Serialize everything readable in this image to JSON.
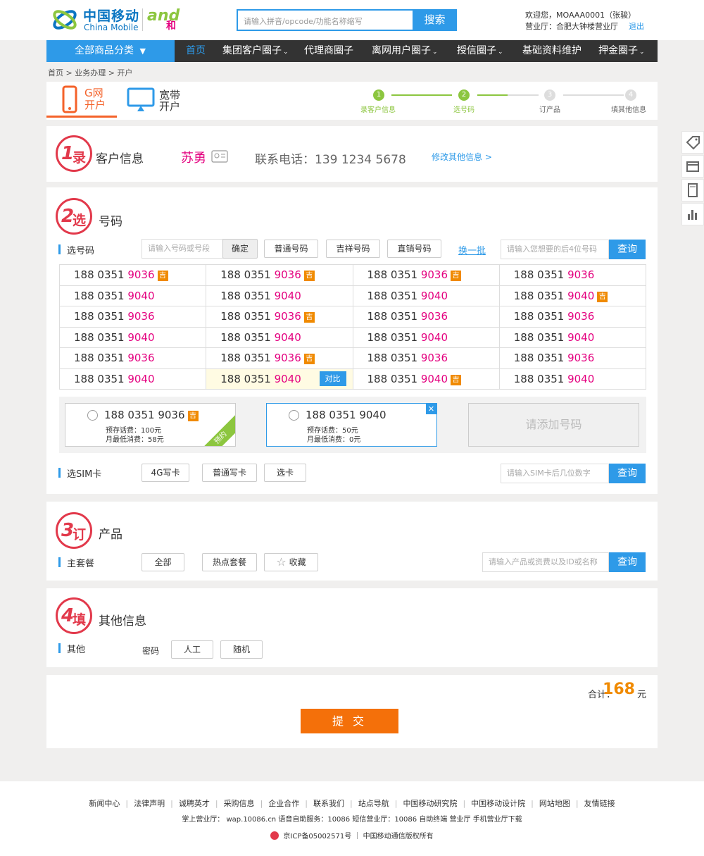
{
  "header": {
    "brand_cn": "中国移动",
    "brand_en": "China Mobile",
    "brand_and": "and",
    "brand_he": "和",
    "search_placeholder": "请输入拼音/opcode/功能名称缩写",
    "search_button": "搜索",
    "welcome": "欢迎您，MOAAA0001（张骏）",
    "office": "营业厅：合肥大钟楼营业厅",
    "logout": "退出"
  },
  "nav": {
    "all_categories": "全部商品分类",
    "items": [
      "首页",
      "集团客户圈子",
      "代理商圈子",
      "离网用户圈子",
      "授信圈子",
      "基础资料维护",
      "押金圈子"
    ]
  },
  "breadcrumb": "首页 > 业务办理 > 开户",
  "open_tabs": {
    "g_label_1": "G网",
    "g_label_2": "开户",
    "bb_label_1": "宽带",
    "bb_label_2": "开户"
  },
  "steps": [
    {
      "num": "1",
      "label": "录客户信息"
    },
    {
      "num": "2",
      "label": "选号码"
    },
    {
      "num": "3",
      "label": "订产品"
    },
    {
      "num": "4",
      "label": "填其他信息"
    }
  ],
  "section1": {
    "badge_num": "1",
    "badge_char": "录",
    "title": "客户信息",
    "customer_name": "苏勇",
    "phone_label": "联系电话：",
    "phone": "139 1234 5678",
    "edit_link": "修改其他信息 >"
  },
  "section2": {
    "badge_num": "2",
    "badge_char": "选",
    "title": "号码",
    "pick_label": "选号码",
    "number_input_placeholder": "请输入号码或号段",
    "confirm": "确定",
    "filters": [
      "普通号码",
      "吉祥号码",
      "直销号码"
    ],
    "refresh": "换一批",
    "tail_input_placeholder": "请输入您想要的后4位号码",
    "query": "查询",
    "lucky_tag": "吉",
    "compare": "对比",
    "numbers": [
      [
        {
          "p": "188 0351 ",
          "t": "9036",
          "j": true
        },
        {
          "p": "188 0351 ",
          "t": "9036",
          "j": true
        },
        {
          "p": "188 0351 ",
          "t": "9036",
          "j": true
        },
        {
          "p": "188 0351 ",
          "t": "9036",
          "j": false
        }
      ],
      [
        {
          "p": "188 0351 ",
          "t": "9040",
          "j": false
        },
        {
          "p": "188 0351 ",
          "t": "9040",
          "j": false
        },
        {
          "p": "188 0351 ",
          "t": "9040",
          "j": false
        },
        {
          "p": "188 0351 ",
          "t": "9040",
          "j": true
        }
      ],
      [
        {
          "p": "188 0351 ",
          "t": "9036",
          "j": false
        },
        {
          "p": "188 0351 ",
          "t": "9036",
          "j": true
        },
        {
          "p": "188 0351 ",
          "t": "9036",
          "j": false
        },
        {
          "p": "188 0351 ",
          "t": "9036",
          "j": false
        }
      ],
      [
        {
          "p": "188 0351 ",
          "t": "9040",
          "j": false
        },
        {
          "p": "188 0351 ",
          "t": "9040",
          "j": false
        },
        {
          "p": "188 0351 ",
          "t": "9040",
          "j": false
        },
        {
          "p": "188 0351 ",
          "t": "9040",
          "j": false
        }
      ],
      [
        {
          "p": "188 0351 ",
          "t": "9036",
          "j": false
        },
        {
          "p": "188 0351 ",
          "t": "9036",
          "j": true
        },
        {
          "p": "188 0351 ",
          "t": "9036",
          "j": false
        },
        {
          "p": "188 0351 ",
          "t": "9036",
          "j": false
        }
      ],
      [
        {
          "p": "188 0351 ",
          "t": "9040",
          "j": false
        },
        {
          "p": "188 0351 ",
          "t": "9040",
          "j": false,
          "sel": true
        },
        {
          "p": "188 0351 ",
          "t": "9040",
          "j": true
        },
        {
          "p": "188 0351 ",
          "t": "9040",
          "j": false
        }
      ]
    ],
    "picked": [
      {
        "number": "188 0351 9036",
        "lucky": true,
        "prestore": "预存话费：100元",
        "min_fee": "月最低消费：58元",
        "ribbon": "预约"
      },
      {
        "number": "188 0351 9040",
        "lucky": false,
        "prestore": "预存话费：50元",
        "min_fee": "月最低消费：0元"
      }
    ],
    "add_number": "请添加号码",
    "sim_label": "选SIM卡",
    "sim_buttons": [
      "4G写卡",
      "普通写卡",
      "选卡"
    ],
    "sim_input_placeholder": "请输入SIM卡后几位数字",
    "sim_query": "查询"
  },
  "section3": {
    "badge_num": "3",
    "badge_char": "订",
    "title": "产品",
    "plan_label": "主套餐",
    "buttons": [
      "全部",
      "热点套餐",
      "收藏"
    ],
    "input_placeholder": "请输入产品或资费以及ID或名称",
    "query": "查询"
  },
  "section4": {
    "badge_num": "4",
    "badge_char": "填",
    "title": "其他信息",
    "other_label": "其他",
    "password_label": "密码",
    "buttons": [
      "人工",
      "随机"
    ]
  },
  "summary": {
    "total_label": "合计：",
    "total": "168",
    "unit": "元",
    "submit": "提 交"
  },
  "footer": {
    "links": [
      "新闻中心",
      "法律声明",
      "诚聘英才",
      "采购信息",
      "企业合作",
      "联系我们",
      "站点导航",
      "中国移动研究院",
      "中国移动设计院",
      "网站地图",
      "友情链接"
    ],
    "line2": "掌上营业厅： wap.10086.cn  语音自助服务：10086  短信营业厅：10086  自助终端  营业厅  手机营业厅下载",
    "line3": "京ICP备05002571号 ｜ 中国移动通信版权所有"
  },
  "colors": {
    "brand_blue": "#2e9ae8",
    "accent_red": "#e2394b",
    "number_tail": "#e4007f",
    "lucky_orange": "#f08a00",
    "submit_orange": "#f4700a",
    "step_green": "#8cc63f"
  }
}
